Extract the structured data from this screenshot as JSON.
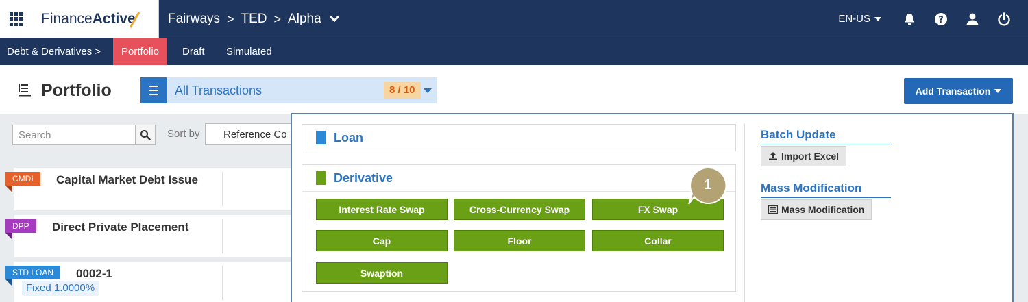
{
  "app": {
    "brand_light": "Finance",
    "brand_bold": "Active"
  },
  "breadcrumb": {
    "items": [
      "Fairways",
      "TED",
      "Alpha"
    ],
    "separator": ">"
  },
  "topbar": {
    "language": "EN-US",
    "icons": [
      "bell-icon",
      "help-icon",
      "user-icon",
      "power-icon"
    ]
  },
  "subnav": {
    "items": [
      "Debt & Derivatives >",
      "Portfolio",
      "Draft",
      "Simulated"
    ],
    "active": "Portfolio"
  },
  "header": {
    "title": "Portfolio",
    "filter_label": "All Transactions",
    "filter_count": "8 / 10",
    "add_button": "Add Transaction"
  },
  "toolbar": {
    "search_placeholder": "Search",
    "sort_label": "Sort by",
    "sort_value": "Reference Co"
  },
  "transactions": [
    {
      "tag": "CMDI",
      "tag_color": "#e4612b",
      "title": "Capital Market Debt Issue"
    },
    {
      "tag": "DPP",
      "tag_color": "#a63bbf",
      "title": "Direct Private Placement"
    },
    {
      "tag": "STD LOAN",
      "tag_color": "#2b8ad8",
      "title": "0002-1",
      "rate": "Fixed 1.0000%"
    }
  ],
  "dropdown": {
    "loan_title": "Loan",
    "derivative_title": "Derivative",
    "derivative_buttons": [
      "Interest Rate Swap",
      "Cross-Currency Swap",
      "FX Swap",
      "Cap",
      "Floor",
      "Collar",
      "Swaption"
    ],
    "batch_update_title": "Batch Update",
    "import_excel_label": "Import Excel",
    "mass_modification_title": "Mass Modification",
    "mass_modification_label": "Mass Modification"
  },
  "callout": {
    "number": "1"
  },
  "colors": {
    "navy": "#1e355e",
    "accent_red": "#e8515b",
    "blue": "#2b74c3",
    "green": "#6aa015",
    "callout": "#b3a273"
  }
}
